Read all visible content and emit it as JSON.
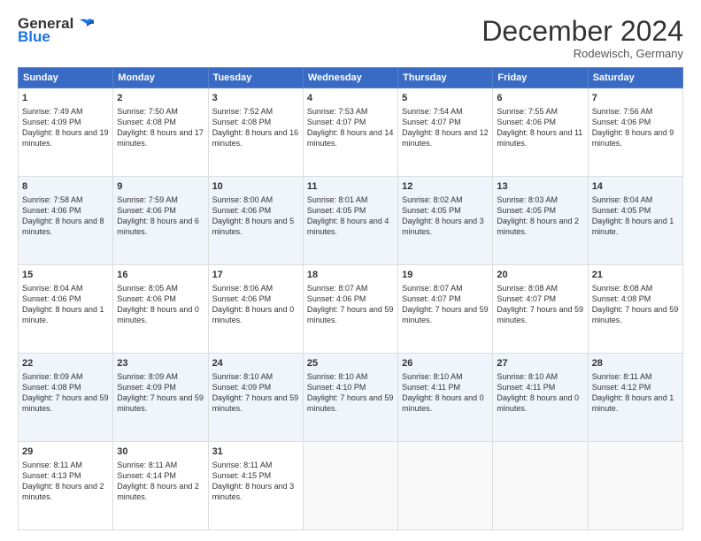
{
  "logo": {
    "line1": "General",
    "line2": "Blue"
  },
  "header": {
    "month": "December 2024",
    "location": "Rodewisch, Germany"
  },
  "days": [
    "Sunday",
    "Monday",
    "Tuesday",
    "Wednesday",
    "Thursday",
    "Friday",
    "Saturday"
  ],
  "weeks": [
    [
      {
        "num": "1",
        "sunrise": "7:49 AM",
        "sunset": "4:09 PM",
        "daylight": "8 hours and 19 minutes."
      },
      {
        "num": "2",
        "sunrise": "7:50 AM",
        "sunset": "4:08 PM",
        "daylight": "8 hours and 17 minutes."
      },
      {
        "num": "3",
        "sunrise": "7:52 AM",
        "sunset": "4:08 PM",
        "daylight": "8 hours and 16 minutes."
      },
      {
        "num": "4",
        "sunrise": "7:53 AM",
        "sunset": "4:07 PM",
        "daylight": "8 hours and 14 minutes."
      },
      {
        "num": "5",
        "sunrise": "7:54 AM",
        "sunset": "4:07 PM",
        "daylight": "8 hours and 12 minutes."
      },
      {
        "num": "6",
        "sunrise": "7:55 AM",
        "sunset": "4:06 PM",
        "daylight": "8 hours and 11 minutes."
      },
      {
        "num": "7",
        "sunrise": "7:56 AM",
        "sunset": "4:06 PM",
        "daylight": "8 hours and 9 minutes."
      }
    ],
    [
      {
        "num": "8",
        "sunrise": "7:58 AM",
        "sunset": "4:06 PM",
        "daylight": "8 hours and 8 minutes."
      },
      {
        "num": "9",
        "sunrise": "7:59 AM",
        "sunset": "4:06 PM",
        "daylight": "8 hours and 6 minutes."
      },
      {
        "num": "10",
        "sunrise": "8:00 AM",
        "sunset": "4:06 PM",
        "daylight": "8 hours and 5 minutes."
      },
      {
        "num": "11",
        "sunrise": "8:01 AM",
        "sunset": "4:05 PM",
        "daylight": "8 hours and 4 minutes."
      },
      {
        "num": "12",
        "sunrise": "8:02 AM",
        "sunset": "4:05 PM",
        "daylight": "8 hours and 3 minutes."
      },
      {
        "num": "13",
        "sunrise": "8:03 AM",
        "sunset": "4:05 PM",
        "daylight": "8 hours and 2 minutes."
      },
      {
        "num": "14",
        "sunrise": "8:04 AM",
        "sunset": "4:05 PM",
        "daylight": "8 hours and 1 minute."
      }
    ],
    [
      {
        "num": "15",
        "sunrise": "8:04 AM",
        "sunset": "4:06 PM",
        "daylight": "8 hours and 1 minute."
      },
      {
        "num": "16",
        "sunrise": "8:05 AM",
        "sunset": "4:06 PM",
        "daylight": "8 hours and 0 minutes."
      },
      {
        "num": "17",
        "sunrise": "8:06 AM",
        "sunset": "4:06 PM",
        "daylight": "8 hours and 0 minutes."
      },
      {
        "num": "18",
        "sunrise": "8:07 AM",
        "sunset": "4:06 PM",
        "daylight": "7 hours and 59 minutes."
      },
      {
        "num": "19",
        "sunrise": "8:07 AM",
        "sunset": "4:07 PM",
        "daylight": "7 hours and 59 minutes."
      },
      {
        "num": "20",
        "sunrise": "8:08 AM",
        "sunset": "4:07 PM",
        "daylight": "7 hours and 59 minutes."
      },
      {
        "num": "21",
        "sunrise": "8:08 AM",
        "sunset": "4:08 PM",
        "daylight": "7 hours and 59 minutes."
      }
    ],
    [
      {
        "num": "22",
        "sunrise": "8:09 AM",
        "sunset": "4:08 PM",
        "daylight": "7 hours and 59 minutes."
      },
      {
        "num": "23",
        "sunrise": "8:09 AM",
        "sunset": "4:09 PM",
        "daylight": "7 hours and 59 minutes."
      },
      {
        "num": "24",
        "sunrise": "8:10 AM",
        "sunset": "4:09 PM",
        "daylight": "7 hours and 59 minutes."
      },
      {
        "num": "25",
        "sunrise": "8:10 AM",
        "sunset": "4:10 PM",
        "daylight": "7 hours and 59 minutes."
      },
      {
        "num": "26",
        "sunrise": "8:10 AM",
        "sunset": "4:11 PM",
        "daylight": "8 hours and 0 minutes."
      },
      {
        "num": "27",
        "sunrise": "8:10 AM",
        "sunset": "4:11 PM",
        "daylight": "8 hours and 0 minutes."
      },
      {
        "num": "28",
        "sunrise": "8:11 AM",
        "sunset": "4:12 PM",
        "daylight": "8 hours and 1 minute."
      }
    ],
    [
      {
        "num": "29",
        "sunrise": "8:11 AM",
        "sunset": "4:13 PM",
        "daylight": "8 hours and 2 minutes."
      },
      {
        "num": "30",
        "sunrise": "8:11 AM",
        "sunset": "4:14 PM",
        "daylight": "8 hours and 2 minutes."
      },
      {
        "num": "31",
        "sunrise": "8:11 AM",
        "sunset": "4:15 PM",
        "daylight": "8 hours and 3 minutes."
      },
      null,
      null,
      null,
      null
    ]
  ]
}
